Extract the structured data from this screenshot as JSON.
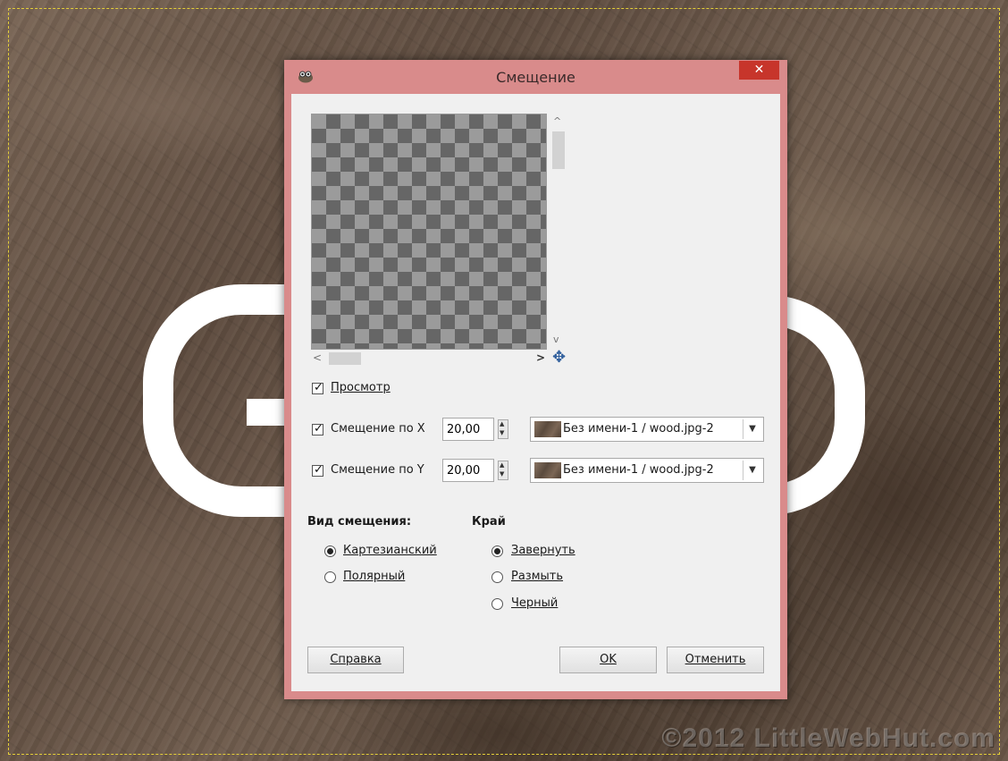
{
  "dialog": {
    "title": "Смещение",
    "close_label": "✕"
  },
  "preview": {
    "checkbox_label": "Просмотр",
    "checked": true
  },
  "offset_x": {
    "label": "Смещение по X",
    "value": "20,00",
    "map": "Без имени-1 / wood.jpg-2",
    "checked": true
  },
  "offset_y": {
    "label": "Смещение по Y",
    "value": "20,00",
    "map": "Без имени-1 / wood.jpg-2",
    "checked": true
  },
  "displacement_type": {
    "heading": "Вид смещения:",
    "options": [
      "Картезианский",
      "Полярный"
    ],
    "selected": "Картезианский"
  },
  "edge": {
    "heading": "Край",
    "options": [
      "Завернуть",
      "Размыть",
      "Черный"
    ],
    "selected": "Завернуть"
  },
  "buttons": {
    "help": "Справка",
    "ok": "OK",
    "cancel": "Отменить"
  },
  "canvas": {
    "watermark": "©2012 LittleWebHut.com"
  },
  "colors": {
    "dialog_frame": "#d98b8b",
    "close_button": "#c7352b",
    "selection_border": "#e4cf38"
  }
}
